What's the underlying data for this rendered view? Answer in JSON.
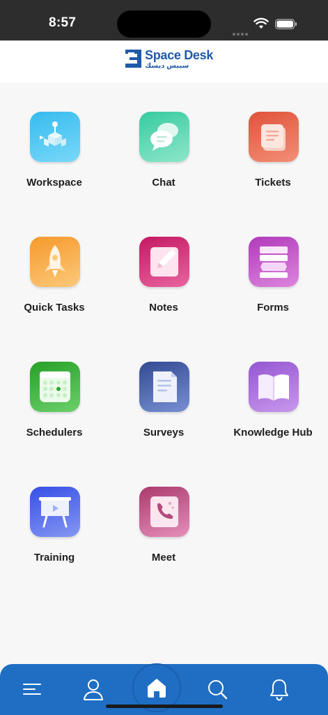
{
  "status_bar": {
    "time": "8:57"
  },
  "header": {
    "logo_text": "Space Desk",
    "logo_arabic": "سبيس ديسك"
  },
  "apps": [
    {
      "label": "Workspace",
      "icon": "workspace-icon",
      "gradient": [
        "#3ec0f0",
        "#6ed3f6"
      ]
    },
    {
      "label": "Chat",
      "icon": "chat-icon",
      "gradient": [
        "#3fcfa5",
        "#86e3c6"
      ]
    },
    {
      "label": "Tickets",
      "icon": "tickets-icon",
      "gradient": [
        "#e35a3d",
        "#f0866c"
      ]
    },
    {
      "label": "Quick Tasks",
      "icon": "rocket-icon",
      "gradient": [
        "#f7a034",
        "#fbc36f"
      ]
    },
    {
      "label": "Notes",
      "icon": "notes-icon",
      "gradient": [
        "#cc1f6a",
        "#e55a96"
      ]
    },
    {
      "label": "Forms",
      "icon": "forms-icon",
      "gradient": [
        "#b63fbf",
        "#d97ad9"
      ]
    },
    {
      "label": "Schedulers",
      "icon": "calendar-icon",
      "gradient": [
        "#2ea52e",
        "#62c962"
      ]
    },
    {
      "label": "Surveys",
      "icon": "surveys-icon",
      "gradient": [
        "#3a4f96",
        "#6f86c9"
      ]
    },
    {
      "label": "Knowledge Hub",
      "icon": "book-icon",
      "gradient": [
        "#9b5ed6",
        "#c18ee8"
      ]
    },
    {
      "label": "Training",
      "icon": "presentation-icon",
      "gradient": [
        "#3c55e8",
        "#7b8ff2"
      ]
    },
    {
      "label": "Meet",
      "icon": "phone-icon",
      "gradient": [
        "#b33f73",
        "#e385b4"
      ]
    }
  ],
  "bottom_nav": [
    {
      "name": "menu",
      "icon": "menu-icon"
    },
    {
      "name": "profile",
      "icon": "user-icon"
    },
    {
      "name": "home",
      "icon": "home-icon",
      "active": true
    },
    {
      "name": "search",
      "icon": "search-icon"
    },
    {
      "name": "notifications",
      "icon": "bell-icon"
    }
  ]
}
